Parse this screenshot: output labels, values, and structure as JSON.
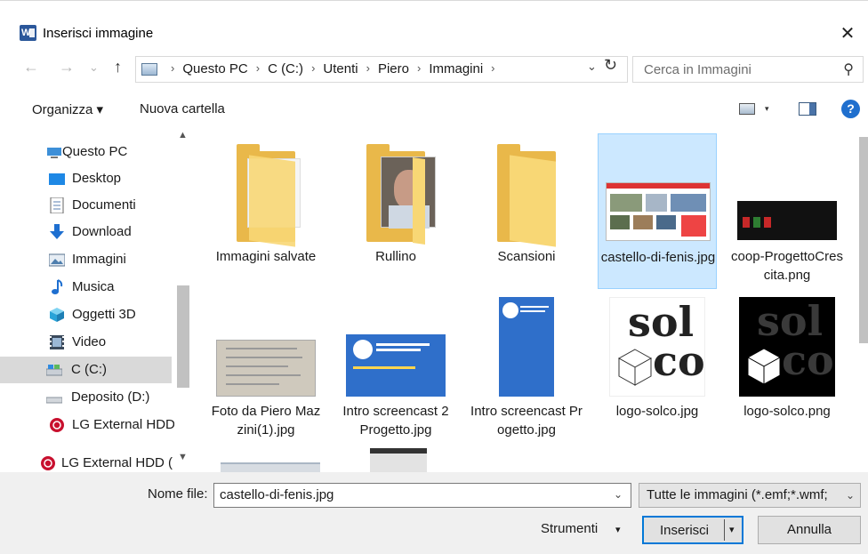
{
  "window": {
    "title": "Inserisci immagine",
    "app_icon": "word-icon",
    "close_glyph": "✕"
  },
  "nav": {
    "back_glyph": "←",
    "forward_glyph": "→",
    "recent_glyph": "⌄",
    "up_glyph": "↑",
    "breadcrumbs": [
      "Questo PC",
      "C (C:)",
      "Utenti",
      "Piero",
      "Immagini"
    ],
    "crumb_sep": "›",
    "refresh_glyph": "↻",
    "search_placeholder": "Cerca in Immagini",
    "search_icon": "⚲"
  },
  "toolbar": {
    "organize_label": "Organizza ▾",
    "new_folder_label": "Nuova cartella",
    "help_glyph": "?"
  },
  "sidebar": {
    "items": [
      {
        "label": "Questo PC",
        "icon": "this-pc-icon"
      },
      {
        "label": "Desktop",
        "icon": "desktop-icon"
      },
      {
        "label": "Documenti",
        "icon": "documents-icon"
      },
      {
        "label": "Download",
        "icon": "download-icon"
      },
      {
        "label": "Immagini",
        "icon": "pictures-icon"
      },
      {
        "label": "Musica",
        "icon": "music-icon"
      },
      {
        "label": "Oggetti 3D",
        "icon": "objects-3d-icon"
      },
      {
        "label": "Video",
        "icon": "video-icon"
      },
      {
        "label": "C (C:)",
        "icon": "drive-icon",
        "selected": true
      },
      {
        "label": "Deposito (D:)",
        "icon": "drive-icon"
      },
      {
        "label": "LG External HDD",
        "icon": "lg-icon"
      },
      {
        "label": "LG External HDD (",
        "icon": "lg-icon"
      }
    ]
  },
  "files": [
    {
      "name": "Immagini salvate",
      "kind": "folder"
    },
    {
      "name": "Rullino",
      "kind": "folder"
    },
    {
      "name": "Scansioni",
      "kind": "folder"
    },
    {
      "name": "castello-di-fenis.jpg",
      "kind": "image",
      "selected": true
    },
    {
      "name": "coop-ProgettoCrescita.png",
      "kind": "image"
    },
    {
      "name": "Foto da Piero Mazzini(1).jpg",
      "kind": "image"
    },
    {
      "name": "Intro screencast 2 Progetto.jpg",
      "kind": "image"
    },
    {
      "name": "Intro screencast Progetto.jpg",
      "kind": "image"
    },
    {
      "name": "logo-solco.jpg",
      "kind": "image"
    },
    {
      "name": "logo-solco.png",
      "kind": "image"
    }
  ],
  "thumb_text": {
    "solco_top": "sol",
    "solco_bottom": "co"
  },
  "bottom": {
    "filename_label": "Nome file:",
    "filename_value": "castello-di-fenis.jpg",
    "filter_value": "Tutte le immagini (*.emf;*.wmf;",
    "tools_label": "Strumenti",
    "insert_label": "Inserisci",
    "cancel_label": "Annulla",
    "dd_glyph": "▾",
    "chevron_glyph": "⌄"
  },
  "colors": {
    "selected_bg": "#cce8ff",
    "accent": "#0078d7",
    "folder": "#f8d775"
  }
}
